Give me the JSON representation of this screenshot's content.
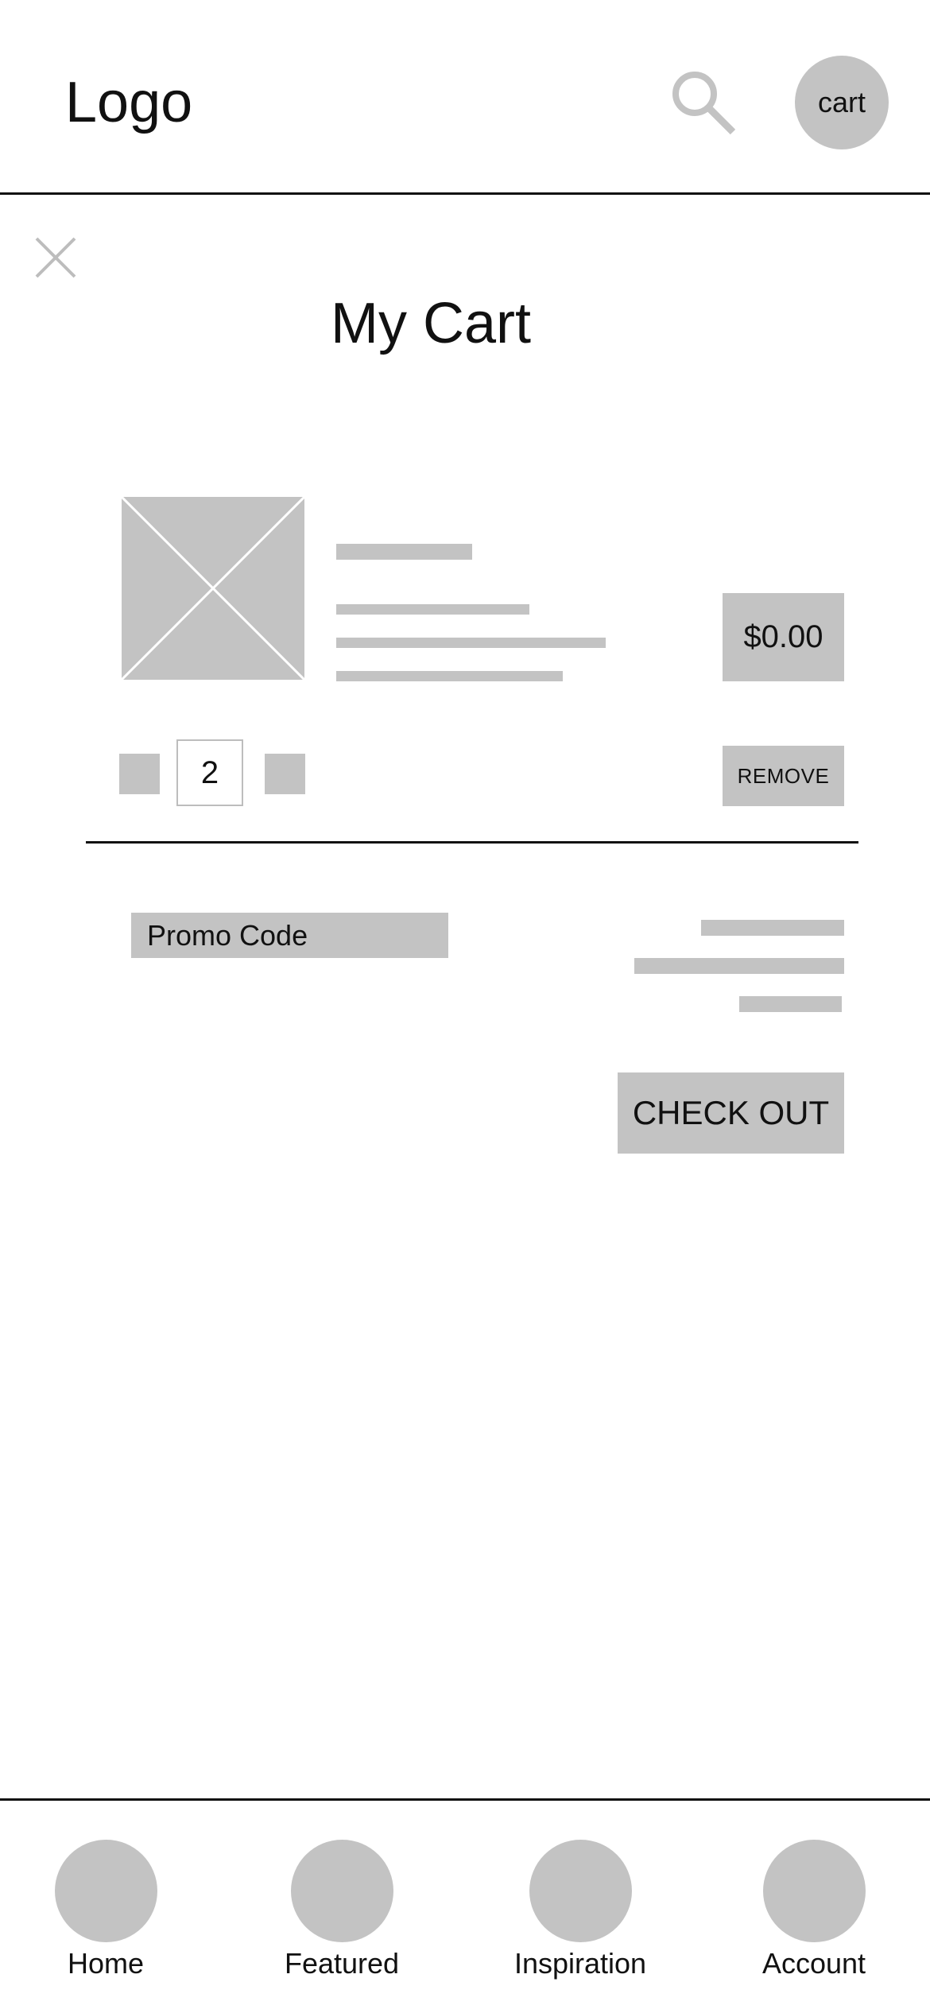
{
  "header": {
    "logo_text": "Logo",
    "search_icon": "search-icon",
    "cart_label": "cart"
  },
  "modal": {
    "close_icon": "close-icon",
    "title": "My Cart"
  },
  "cart_item": {
    "image_icon": "image-placeholder-icon",
    "price": "$0.00",
    "quantity": "2",
    "remove_label": "REMOVE"
  },
  "summary": {
    "promo_placeholder": "Promo Code",
    "checkout_label": "CHECK OUT"
  },
  "bottom_nav": {
    "items": [
      {
        "label": "Home"
      },
      {
        "label": "Featured"
      },
      {
        "label": "Inspiration"
      },
      {
        "label": "Account"
      }
    ]
  },
  "colors": {
    "placeholder_gray": "#c3c3c3",
    "text": "#111111",
    "background": "#ffffff"
  }
}
